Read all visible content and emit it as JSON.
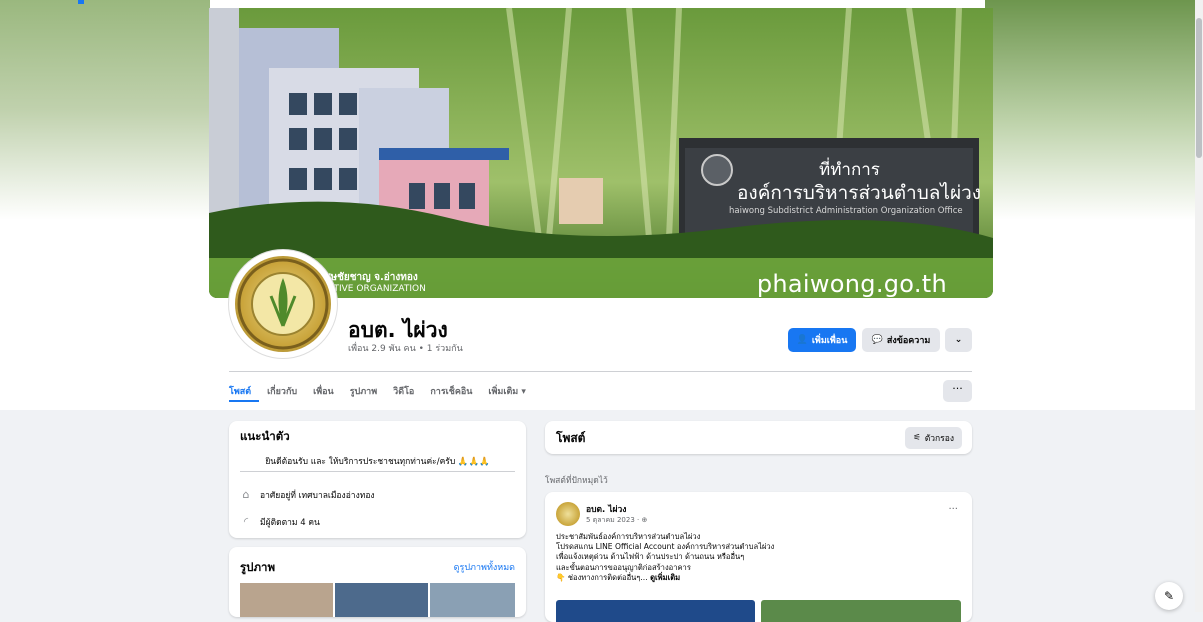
{
  "cover": {
    "sign_line1": "ที่ทำการ",
    "sign_line2": "องค์การบริหารส่วนตำบลไผ่วง",
    "sign_english": "haiwong Subdistrict Administration Organization Office",
    "banner_thai": "นตำบลไผ่วง อ.วิเศษชัยชาญ จ.อ่างทอง",
    "banner_english": "TRICT ADMINISTRATIVE ORGANIZATION",
    "banner_url": "phaiwong.go.th"
  },
  "profile": {
    "name": "อบต. ไผ่วง",
    "friends_line": "เพื่อน 2.9 พัน คน • 1 ร่วมกัน"
  },
  "actions": {
    "add_friend": "เพิ่มเพื่อน",
    "message": "ส่งข้อความ",
    "more": "⌄"
  },
  "tabs": [
    {
      "label": "โพสต์"
    },
    {
      "label": "เกี่ยวกับ"
    },
    {
      "label": "เพื่อน"
    },
    {
      "label": "รูปภาพ"
    },
    {
      "label": "วิดีโอ"
    },
    {
      "label": "การเช็คอิน"
    },
    {
      "label": "เพิ่มเติม ▾"
    }
  ],
  "tab_overflow": "···",
  "intro": {
    "title": "แนะนำตัว",
    "bio": "ยินดีต้อนรับ และ ให้บริการประชาชนทุกท่านค่ะ/ครับ 🙏🙏🙏",
    "lives_in": "อาศัยอยู่ที่ เทศบาลเมืองอ่างทอง",
    "followers": "มีผู้ติดตาม 4 คน"
  },
  "photos": {
    "title": "รูปภาพ",
    "see_all": "ดูรูปภาพทั้งหมด"
  },
  "posts": {
    "title": "โพสต์",
    "filter": "ตัวกรอง",
    "pinned_label": "โพสต์ที่ปักหมุดไว้"
  },
  "post": {
    "author": "อบต. ไผ่วง",
    "date": "5 ตุลาคม 2023 · ⊕",
    "more": "···",
    "lines": [
      "ประชาสัมพันธ์องค์การบริหารส่วนตำบลไผ่วง",
      "โปรดสแกน LINE Official Account  องค์การบริหารส่วนตำบลไผ่วง",
      "เพื่อแจ้งเหตุด่วน ด้านไฟฟ้า ด้านประปา ด้านถนน หรืออื่นๆ",
      "และขั้นตอนการขออนุญาติก่อสร้างอาคาร"
    ],
    "last_line": "👇 ช่องทางการติดต่ออื่นๆ... ",
    "see_more": "ดูเพิ่มเติม"
  },
  "icons": {
    "home": "home-icon",
    "rss": "followers-icon",
    "filter": "filter-icon",
    "compose": "compose-icon"
  },
  "colors": {
    "accent": "#1877f2",
    "background": "#f0f2f5"
  }
}
